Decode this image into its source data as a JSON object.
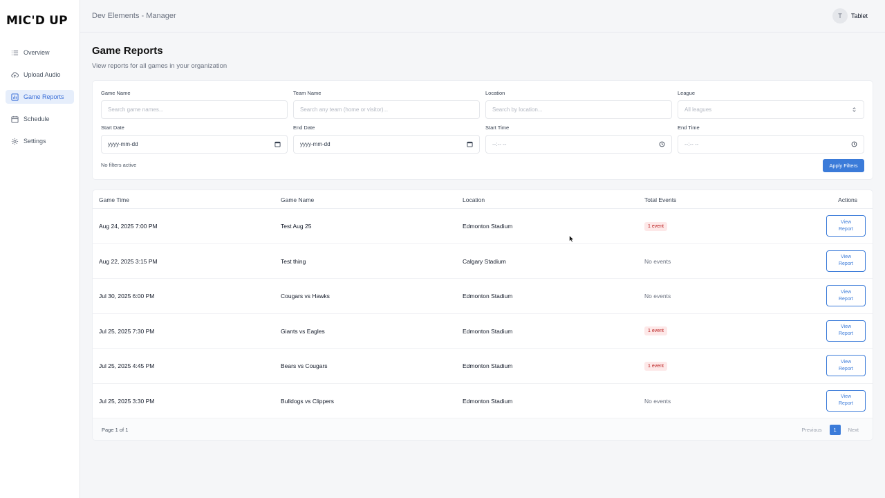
{
  "app": {
    "logo": "MIC'D UP"
  },
  "sidebar": {
    "items": [
      {
        "label": "Overview",
        "icon": "list-icon"
      },
      {
        "label": "Upload Audio",
        "icon": "cloud-upload-icon"
      },
      {
        "label": "Game Reports",
        "icon": "chart-icon",
        "active": true
      },
      {
        "label": "Schedule",
        "icon": "calendar-icon"
      },
      {
        "label": "Settings",
        "icon": "gear-icon"
      }
    ]
  },
  "header": {
    "title": "Dev Elements - Manager",
    "user": {
      "initial": "T",
      "name": "Tablet"
    }
  },
  "page": {
    "title": "Game Reports",
    "subtitle": "View reports for all games in your organization"
  },
  "filters": {
    "game_name": {
      "label": "Game Name",
      "placeholder": "Search game names..."
    },
    "team_name": {
      "label": "Team Name",
      "placeholder": "Search any team (home or visitor)..."
    },
    "location": {
      "label": "Location",
      "placeholder": "Search by location..."
    },
    "league": {
      "label": "League",
      "value": "All leagues"
    },
    "start_date": {
      "label": "Start Date",
      "value": "yyyy-mm-dd"
    },
    "end_date": {
      "label": "End Date",
      "value": "yyyy-mm-dd"
    },
    "start_time": {
      "label": "Start Time",
      "value": "--:-- --"
    },
    "end_time": {
      "label": "End Time",
      "value": "--:-- --"
    },
    "status": "No filters active",
    "apply_label": "Apply Filters"
  },
  "table": {
    "columns": [
      "Game Time",
      "Game Name",
      "Location",
      "Total Events",
      "Actions"
    ],
    "action_label_1": "View",
    "action_label_2": "Report",
    "rows": [
      {
        "time": "Aug 24, 2025 7:00 PM",
        "name": "Test Aug 25",
        "location": "Edmonton Stadium",
        "events": "1 event",
        "has_events": true
      },
      {
        "time": "Aug 22, 2025 3:15 PM",
        "name": "Test thing",
        "location": "Calgary Stadium",
        "events": "No events",
        "has_events": false
      },
      {
        "time": "Jul 30, 2025 6:00 PM",
        "name": "Cougars vs Hawks",
        "location": "Edmonton Stadium",
        "events": "No events",
        "has_events": false
      },
      {
        "time": "Jul 25, 2025 7:30 PM",
        "name": "Giants vs Eagles",
        "location": "Edmonton Stadium",
        "events": "1 event",
        "has_events": true
      },
      {
        "time": "Jul 25, 2025 4:45 PM",
        "name": "Bears vs Cougars",
        "location": "Edmonton Stadium",
        "events": "1 event",
        "has_events": true
      },
      {
        "time": "Jul 25, 2025 3:30 PM",
        "name": "Bulldogs vs Clippers",
        "location": "Edmonton Stadium",
        "events": "No events",
        "has_events": false
      }
    ]
  },
  "pagination": {
    "info": "Page 1 of 1",
    "previous": "Previous",
    "current": "1",
    "next": "Next"
  },
  "colors": {
    "accent": "#3b7bd9",
    "active_nav_bg": "#e6eefb",
    "badge_bg": "#fde8e8",
    "badge_text": "#b91c1c"
  }
}
